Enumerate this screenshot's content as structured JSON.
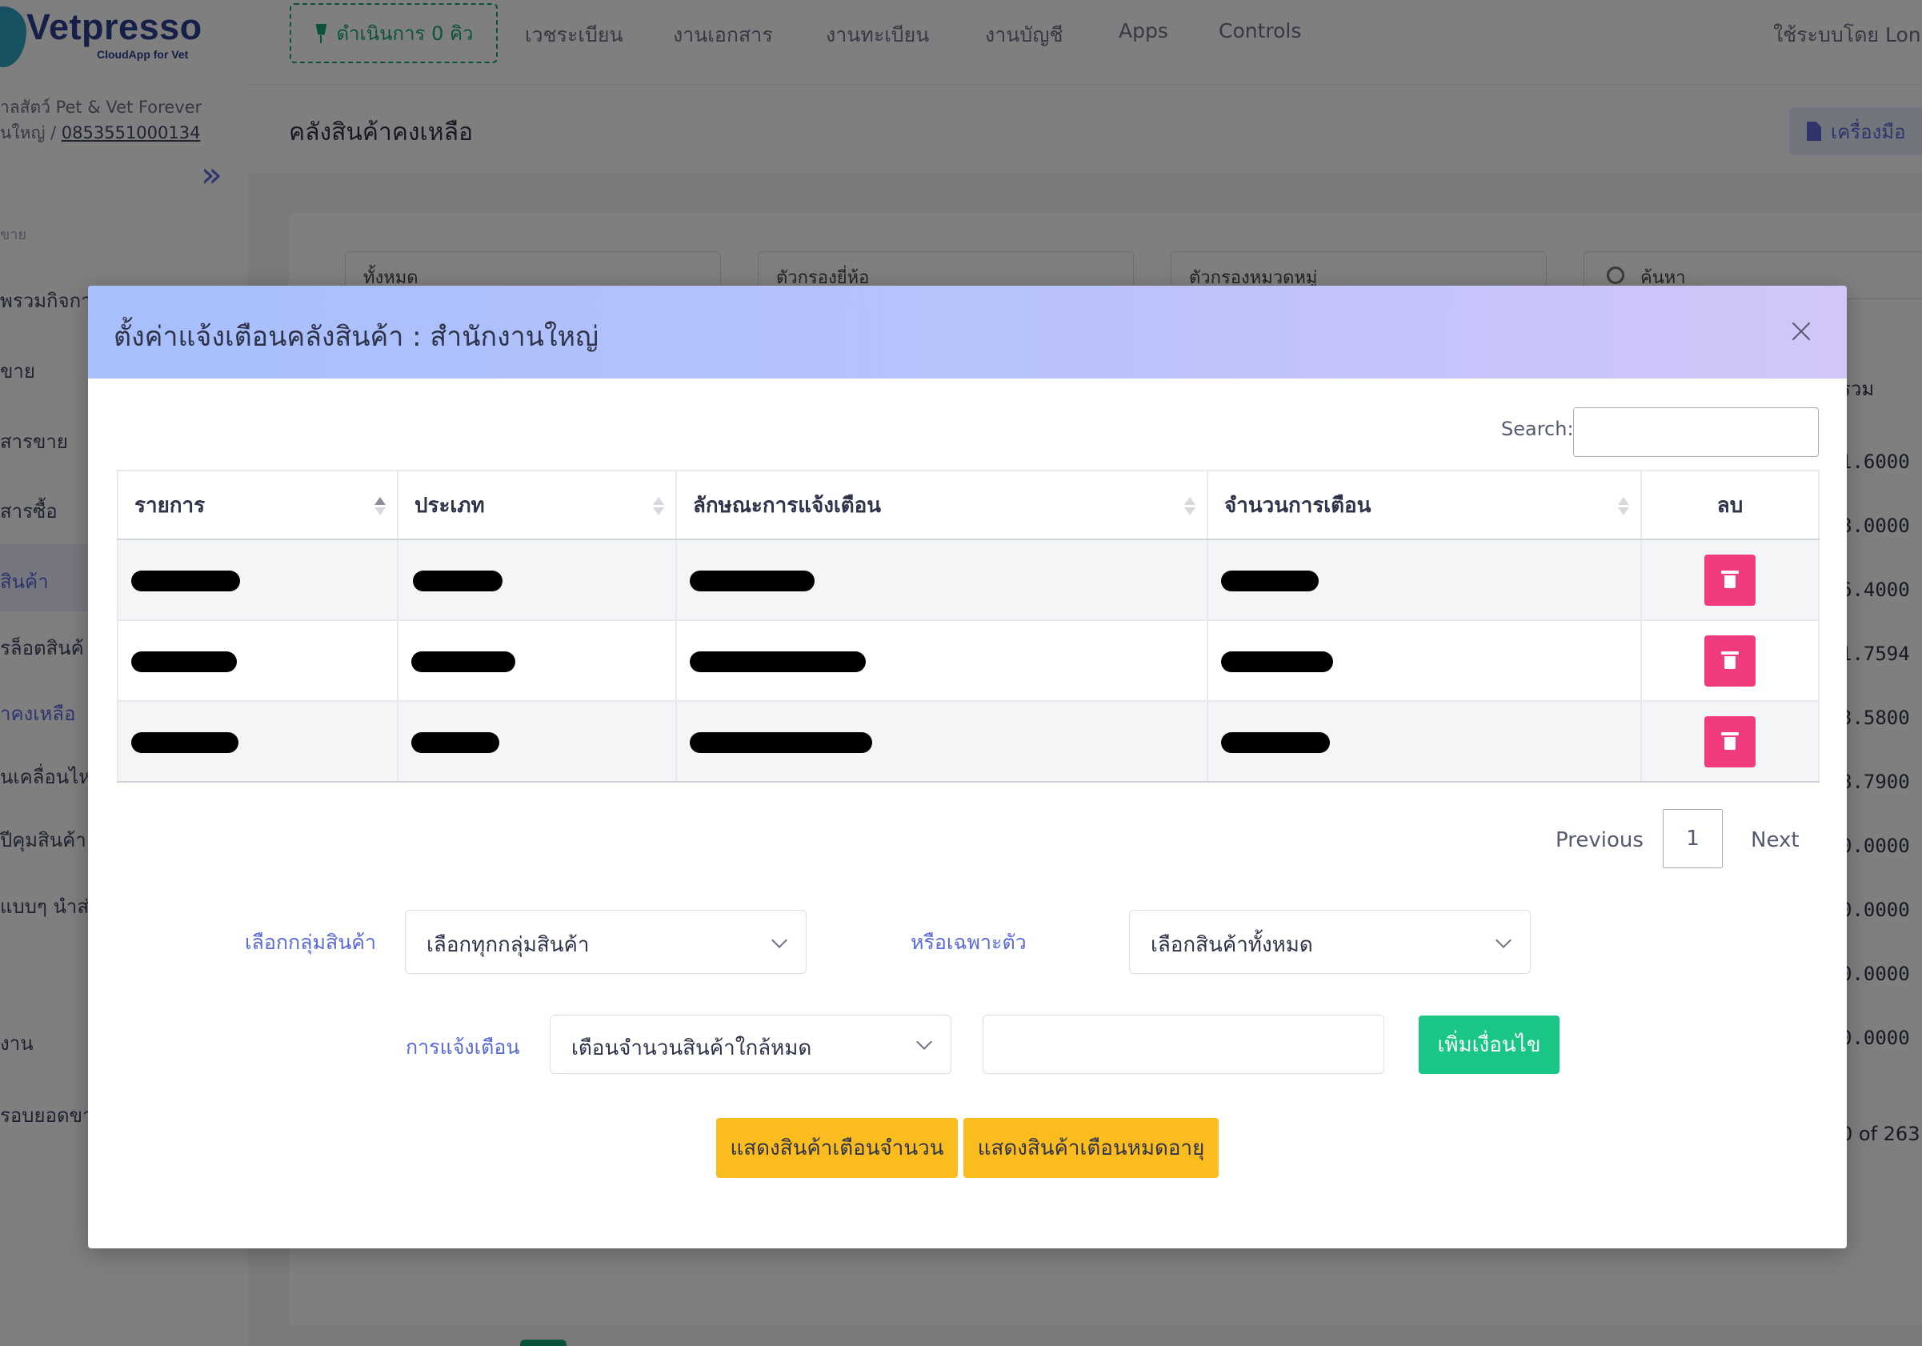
{
  "sidebar": {
    "brand": "Vetpresso",
    "tagline": "CloudApp for Vet",
    "clinic": "าลสัตว์ Pet & Vet Forever",
    "branch_prefix": "นใหญ่ / ",
    "phone": "0853551000134",
    "section": "ขาย",
    "items": [
      {
        "label": "พรวมกิจกา"
      },
      {
        "label": "ขาย"
      },
      {
        "label": "สารขาย"
      },
      {
        "label": "สารซื้อ"
      },
      {
        "label": "สินค้า"
      },
      {
        "label": "รล็อตสินค้"
      },
      {
        "label": "าคงเหลือ"
      },
      {
        "label": "นเคลื่อนไห"
      },
      {
        "label": "ปีคุมสินค้า"
      },
      {
        "label": "แบบๆ นำส่"
      },
      {
        "label": "งาน"
      },
      {
        "label": "รอบยอดขา"
      }
    ]
  },
  "topbar": {
    "queue_label": "ดำเนินการ 0 คิว",
    "nav": [
      "เวชระเบียน",
      "งานเอกสาร",
      "งานทะเบียน",
      "งานบัญชี",
      "Apps",
      "Controls"
    ],
    "user_text": "ใช้ระบบโดย Lon"
  },
  "page": {
    "title": "คลังสินค้าคงเหลือ",
    "tools_label": "เครื่องมือ",
    "filters": [
      "ทั้งหมด",
      "ตัวกรองยี่ห้อ",
      "ตัวกรองหมวดหมู่",
      "ค้นหา"
    ],
    "right_header": "รวม",
    "right_values": [
      "1.6000",
      "8.0000",
      "6.4000",
      "1.7594",
      "3.5800",
      "8.7900",
      "0.0000",
      "0.0000",
      "0.0000",
      "0.0000"
    ],
    "right_footer": "0 of 263"
  },
  "modal": {
    "title": "ตั้งค่าแจ้งเตือนคลังสินค้า : สำนักงานใหญ่",
    "search_label": "Search:",
    "search_value": "",
    "columns": [
      "รายการ",
      "ประเภท",
      "ลักษณะการแจ้งเตือน",
      "จำนวนการเตือน",
      "ลบ"
    ],
    "rows": [
      {
        "cells": [
          "",
          "",
          "",
          ""
        ]
      },
      {
        "cells": [
          "",
          "",
          "",
          ""
        ]
      },
      {
        "cells": [
          "",
          "",
          "",
          ""
        ]
      }
    ],
    "pager": {
      "previous": "Previous",
      "page": "1",
      "next": "Next"
    },
    "form": {
      "group_label": "เลือกกลุ่มสินค้า",
      "group_value": "เลือกทุกกลุ่มสินค้า",
      "item_label": "หรือเฉพาะตัว",
      "item_value": "เลือกสินค้าทั้งหมด",
      "alert_label": "การแจ้งเตือน",
      "alert_value": "เตือนจำนวนสินค้าใกล้หมด",
      "amount_value": "",
      "add_button": "เพิ่มเงื่อนไข"
    },
    "show_qty_button": "แสดงสินค้าเตือนจำนวน",
    "show_expiry_button": "แสดงสินค้าเตือนหมดอายุ"
  },
  "colors": {
    "accent": "#5a6bd8",
    "success": "#19c686",
    "danger": "#f23b7e",
    "warning": "#fbbc1f"
  }
}
